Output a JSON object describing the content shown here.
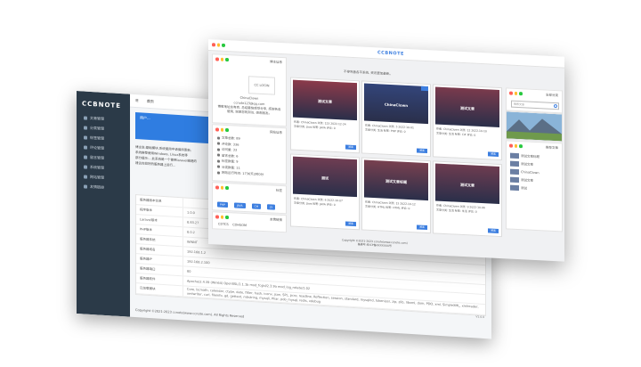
{
  "admin": {
    "logo": "CCBNOTE",
    "menu": [
      "文章管理",
      "分类管理",
      "标签管理",
      "评论管理",
      "留言管理",
      "系统管理",
      "网站管理",
      "友情链接"
    ],
    "topbar": [
      "首页",
      "首页"
    ],
    "card": {
      "label": "用户...",
      "value": "2"
    },
    "notes": [
      "博主说:基础模块,系统使用中请保持更新;",
      "系统推荐使用Windows, Linux系统等",
      "部分提示:...此系统是一个使用laravel搭建的",
      "建议在较好的服务器上运行..."
    ],
    "table": [
      {
        "k": "服务器版本信息",
        "v": ""
      },
      {
        "k": "程序版本",
        "v": "1.0.0"
      },
      {
        "k": "Laravel版本",
        "v": "8.83.27"
      },
      {
        "k": "PHP版本",
        "v": "8.0.2"
      },
      {
        "k": "服务器系统",
        "v": "WINNT"
      },
      {
        "k": "服务器域名",
        "v": "192.168.1.2"
      },
      {
        "k": "服务器IP",
        "v": "192.168.2.100"
      },
      {
        "k": "服务器端口",
        "v": "80"
      },
      {
        "k": "服务器软件",
        "v": "Apache/2.4.39 (Win64) OpenSSL/1.1.1b mod_fcgid/2.3.9a mod_log_rotate/1.02"
      },
      {
        "k": "已加载模块",
        "v": "Core, bcmath, calendar, ctype, date, filter, hash, iconv, json, SPL, pcre, readline, Reflection, session, standard, mysqlnd, tokenizer, zip, zlib, libxml, dom, PDO, xml, SimpleXML, xmlreader, xmlwriter, curl, fileinfo, gd, gettext, mbstring, mysqli, Phar, pdo_mysql, redis, xdebug"
      }
    ],
    "footer": "Copyright ©2021-2023 ccnote(www.ccnote.com). All Rights Reserved",
    "version": "V1.0.0"
  },
  "blog": {
    "brand": "CCBNOTE",
    "notice": "不停完善各平系统, 资讯更加最新。",
    "profile": {
      "header": "博主信息",
      "avatar": "CC LOGIN",
      "name": "ChinaClown",
      "email": "ccnote123@qq.com",
      "bio": "博客地址总有商, 总结最快感受分享, 感谢各各使用, 谢谢您的到访, 感谢朋友。"
    },
    "stats": {
      "header": "网站信息",
      "items": [
        "文章总数: 89",
        "评论数: 336",
        "访问量: 33",
        "留言总数: 6",
        "标签数量: 9",
        "分类数量: 11",
        "网站运行时间: 1736天2时0分"
      ]
    },
    "tags": {
      "header": "标签",
      "items": [
        "PHP",
        "JAVA",
        "C#",
        "JS",
        "ASP",
        "HTML",
        "LARAVEL"
      ]
    },
    "links": {
      "header": "友情链接",
      "items": [
        "CDTCS",
        "COHSOM"
      ]
    },
    "posts": [
      {
        "caption": "测试文章",
        "meta": "作者: ChinaClown  浏览: 123  2022-12-24",
        "tags": "文章分类: Java  标签: JAVA  评论: 0",
        "btn": "阅读",
        "color": "#8b3a4a"
      },
      {
        "caption": "ChinaClown",
        "meta": "作者: ChinaClown  浏览: 5  2022-10-01",
        "tags": "文章分类: 生活  标签: PHP  评论: 0",
        "btn": "阅读",
        "color": "#33457a"
      },
      {
        "caption": "测试文章",
        "meta": "作者: ChinaClown  浏览: 12  2022-10-10",
        "tags": "文章分类: 生活  标签: C#  评论: 0",
        "btn": "阅读",
        "color": "#7a3a4c"
      },
      {
        "caption": "测试",
        "meta": "作者: ChinaClown  浏览: 6  2022-10-07",
        "tags": "文章分类: Java  标签: JAVA  评论: 0",
        "btn": "阅读",
        "color": "#6f3d52"
      },
      {
        "caption": "测试文章标题",
        "meta": "作者: ChinaClown  浏览: 15  2022-10-12",
        "tags": "文章分类: HTML  标签: HTML  评论: 0",
        "btn": "阅读",
        "color": "#78404f"
      },
      {
        "caption": "测试文章",
        "meta": "作者: ChinaClown  浏览: 9  2022-10-06",
        "tags": "文章分类: 生活  标签: 生活  评论: 0",
        "btn": "阅读",
        "color": "#6e3c50"
      }
    ],
    "right": {
      "search_header": "全部分类",
      "search_placeholder": "搜索文章",
      "recent_header": "推荐文章",
      "recent": [
        "测试文章标题",
        "测试文章",
        "ChinaClown",
        "测试文章",
        "测试"
      ]
    },
    "copyright": [
      "Copyright ©2021-2023 ccnote(www.ccnote.com)",
      "备案号:粤ICP备XXXXXXX号"
    ]
  }
}
